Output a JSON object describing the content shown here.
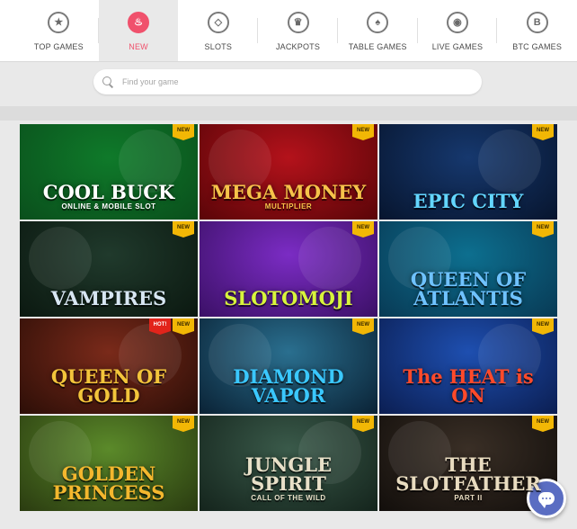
{
  "nav": {
    "items": [
      {
        "label": "TOP GAMES",
        "icon": "star-icon",
        "glyph": "★",
        "active": false
      },
      {
        "label": "NEW",
        "icon": "flame-icon",
        "glyph": "♨",
        "active": true
      },
      {
        "label": "SLOTS",
        "icon": "diamond-icon",
        "glyph": "◇",
        "active": false
      },
      {
        "label": "JACKPOTS",
        "icon": "trophy-icon",
        "glyph": "♛",
        "active": false
      },
      {
        "label": "TABLE GAMES",
        "icon": "spade-icon",
        "glyph": "♠",
        "active": false
      },
      {
        "label": "LIVE GAMES",
        "icon": "lips-icon",
        "glyph": "◉",
        "active": false
      },
      {
        "label": "BTC GAMES",
        "icon": "bitcoin-icon",
        "glyph": "B",
        "active": false
      }
    ],
    "active_color": "#f0516c"
  },
  "search": {
    "placeholder": "Find your game"
  },
  "games": [
    {
      "title": "COOL BUCK",
      "subtitle": "ONLINE & MOBILE SLOT",
      "badge": "NEW",
      "hot": false,
      "bg": [
        "#0f7a2a",
        "#0a4f1c"
      ],
      "color": "#ffffff"
    },
    {
      "title": "MEGA MONEY",
      "subtitle": "MULTIPLIER",
      "badge": "NEW",
      "hot": false,
      "bg": [
        "#b4121b",
        "#5a0508"
      ],
      "color": "#f6c34a"
    },
    {
      "title": "EPIC CITY",
      "subtitle": "",
      "badge": "NEW",
      "hot": false,
      "bg": [
        "#16386e",
        "#07152e"
      ],
      "color": "#63d6ff"
    },
    {
      "title": "VAMPIRES",
      "subtitle": "",
      "badge": "NEW",
      "hot": false,
      "bg": [
        "#203a2c",
        "#0b1810"
      ],
      "color": "#d7e6f2"
    },
    {
      "title": "SLOTOMOJI",
      "subtitle": "",
      "badge": "NEW",
      "hot": false,
      "bg": [
        "#7b2cc4",
        "#3b1066"
      ],
      "color": "#d8f43c"
    },
    {
      "title": "QUEEN OF ATLANTIS",
      "subtitle": "",
      "badge": "NEW",
      "hot": false,
      "bg": [
        "#0d6f8f",
        "#083a55"
      ],
      "color": "#6fc2ff"
    },
    {
      "title": "QUEEN OF GOLD",
      "subtitle": "",
      "badge": "NEW",
      "hot": true,
      "hot_label": "HOT!",
      "bg": [
        "#7a2a1a",
        "#2c0e07"
      ],
      "color": "#f3c53b"
    },
    {
      "title": "DIAMOND VAPOR",
      "subtitle": "",
      "badge": "NEW",
      "hot": false,
      "bg": [
        "#2a6f8f",
        "#0a2235"
      ],
      "color": "#3ac8ff"
    },
    {
      "title": "The HEAT is ON",
      "subtitle": "",
      "badge": "NEW",
      "hot": false,
      "bg": [
        "#1e4fb0",
        "#0b1e52"
      ],
      "color": "#ff4a2a"
    },
    {
      "title": "GOLDEN PRINCESS",
      "subtitle": "",
      "badge": "NEW",
      "hot": false,
      "bg": [
        "#5b8a2a",
        "#2a3b10"
      ],
      "color": "#f4b72e"
    },
    {
      "title": "JUNGLE SPIRIT",
      "subtitle": "CALL OF THE WILD",
      "badge": "NEW",
      "hot": false,
      "bg": [
        "#3a5a4a",
        "#14241c"
      ],
      "color": "#e8e0c8"
    },
    {
      "title": "THE SLOTFATHER",
      "subtitle": "PART II",
      "badge": "NEW",
      "hot": false,
      "bg": [
        "#3a2f26",
        "#120e0b"
      ],
      "color": "#e9dcc0"
    }
  ],
  "chat": {
    "icon": "chat-icon",
    "color": "#5a6dc2"
  }
}
